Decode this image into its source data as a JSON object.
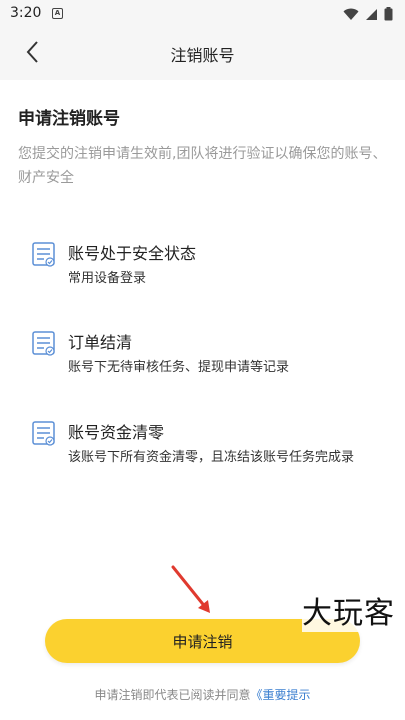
{
  "status_bar": {
    "time": "3:20",
    "app_icon_letter": "A",
    "icons": [
      "wifi-icon",
      "signal-icon",
      "battery-icon"
    ]
  },
  "nav": {
    "back_icon": "chevron-left-icon",
    "title": "注销账号"
  },
  "main": {
    "title": "申请注销账号",
    "description": "您提交的注销申请生效前,团队将进行验证以确保您的账号、财产安全",
    "conditions": [
      {
        "icon": "document-list-icon",
        "title": "账号处于安全状态",
        "subtitle": "常用设备登录"
      },
      {
        "icon": "document-list-icon",
        "title": "订单结清",
        "subtitle": "账号下无待审核任务、提现申请等记录"
      },
      {
        "icon": "document-list-icon",
        "title": "账号资金清零",
        "subtitle": "该账号下所有资金清零，且冻结该账号任务完成录"
      }
    ]
  },
  "apply_button": {
    "label": "申请注销"
  },
  "agreement": {
    "prefix": "申请注销即代表已阅读并同意",
    "link": "《重要提示"
  },
  "watermark": "大玩客",
  "colors": {
    "accent": "#fbd12f",
    "link": "#3b7fd0",
    "icon_blue": "#5b8fd6",
    "arrow": "#e03a2f"
  }
}
